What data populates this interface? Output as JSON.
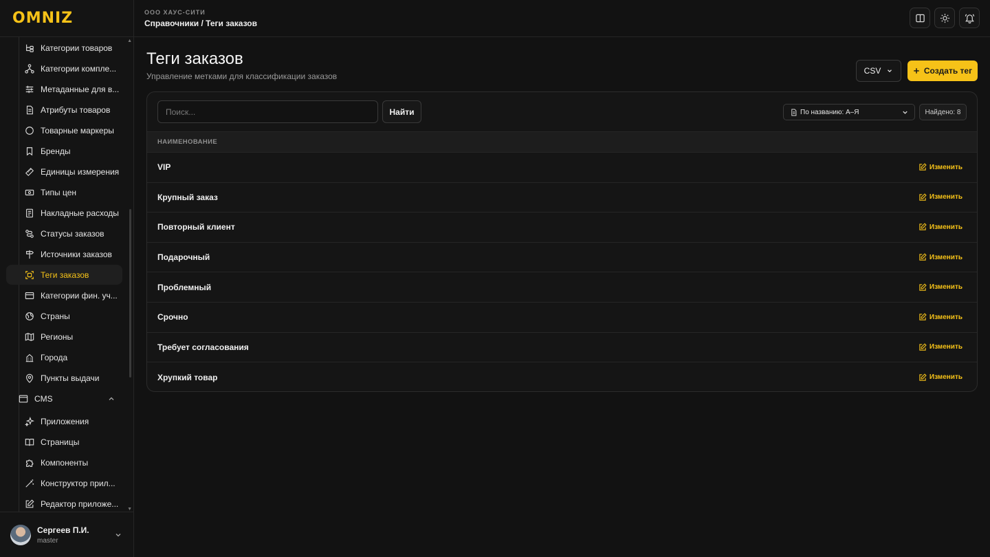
{
  "app": {
    "logo": "OMNIZ",
    "org": "ООО ХАУС-СИТИ",
    "breadcrumb": "Справочники / Теги заказов"
  },
  "sidebar": {
    "items": [
      {
        "label": "Категории товаров",
        "icon": "category-tree-icon"
      },
      {
        "label": "Категории компле...",
        "icon": "hierarchy-icon"
      },
      {
        "label": "Метаданные для в...",
        "icon": "sliders-icon"
      },
      {
        "label": "Атрибуты товаров",
        "icon": "document-icon"
      },
      {
        "label": "Товарные маркеры",
        "icon": "circle-icon"
      },
      {
        "label": "Бренды",
        "icon": "bookmark-icon"
      },
      {
        "label": "Единицы измерения",
        "icon": "ruler-icon"
      },
      {
        "label": "Типы цен",
        "icon": "banknote-icon"
      },
      {
        "label": "Накладные расходы",
        "icon": "receipt-icon"
      },
      {
        "label": "Статусы заказов",
        "icon": "route-icon"
      },
      {
        "label": "Источники заказов",
        "icon": "signpost-icon"
      },
      {
        "label": "Теги заказов",
        "icon": "tag-scan-icon"
      },
      {
        "label": "Категории фин. уч...",
        "icon": "card-icon"
      },
      {
        "label": "Страны",
        "icon": "globe-icon"
      },
      {
        "label": "Регионы",
        "icon": "map-icon"
      },
      {
        "label": "Города",
        "icon": "building-icon"
      },
      {
        "label": "Пункты выдачи",
        "icon": "map-pin-icon"
      }
    ],
    "group": {
      "label": "CMS",
      "icon": "browser-window-icon"
    },
    "cms_items": [
      {
        "label": "Приложения",
        "icon": "sparkles-icon"
      },
      {
        "label": "Страницы",
        "icon": "book-open-icon"
      },
      {
        "label": "Компоненты",
        "icon": "puzzle-icon"
      },
      {
        "label": "Конструктор прил...",
        "icon": "magic-wand-icon"
      },
      {
        "label": "Редактор приложе...",
        "icon": "edit-square-icon"
      }
    ],
    "active": "Теги заказов"
  },
  "user": {
    "name": "Сергеев П.И.",
    "role": "master"
  },
  "page": {
    "title": "Теги заказов",
    "subtitle": "Управление метками для классификации заказов",
    "csv_label": "CSV",
    "create_label": "Создать тег"
  },
  "toolbar": {
    "search_placeholder": "Поиск...",
    "find_label": "Найти",
    "sort_label": "По названию: А–Я",
    "found_label": "Найдено: 8"
  },
  "table": {
    "header": "НАИМЕНОВАНИЕ",
    "edit_label": "Изменить",
    "rows": [
      "VIP",
      "Крупный заказ",
      "Повторный клиент",
      "Подарочный",
      "Проблемный",
      "Срочно",
      "Требует согласования",
      "Хрупкий товар"
    ]
  },
  "colors": {
    "accent": "#f6c218",
    "background": "#121212",
    "panel": "#151515"
  }
}
